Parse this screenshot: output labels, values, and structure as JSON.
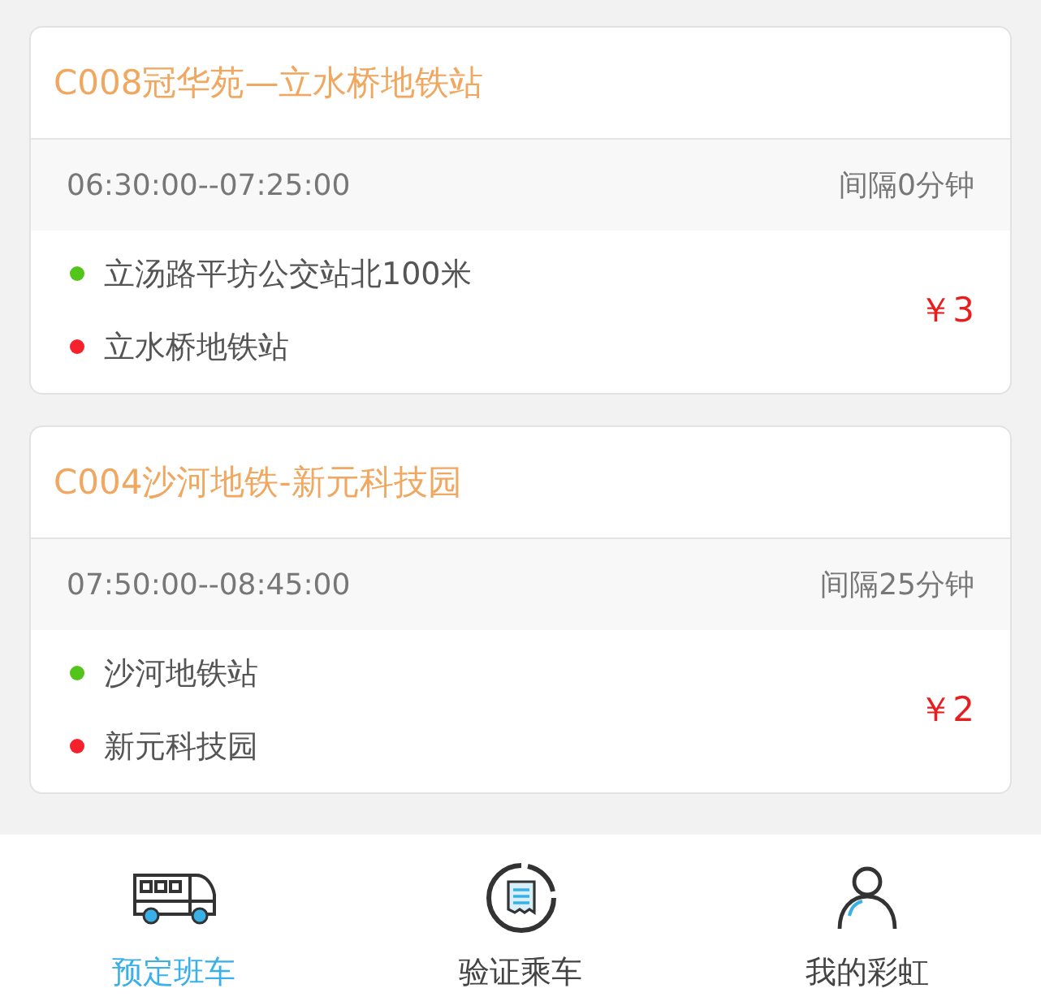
{
  "routes": [
    {
      "title": "C008冠华苑—立水桥地铁站",
      "time": "06:30:00--07:25:00",
      "interval": "间隔0分钟",
      "price": "￥3",
      "stops": [
        {
          "name": "立汤路平坊公交站北100米",
          "color": "#52c41a"
        },
        {
          "name": "立水桥地铁站",
          "color": "#f5222d"
        }
      ]
    },
    {
      "title": "C004沙河地铁-新元科技园",
      "time": "07:50:00--08:45:00",
      "interval": "间隔25分钟",
      "price": "￥2",
      "stops": [
        {
          "name": "沙河地铁站",
          "color": "#52c41a"
        },
        {
          "name": "新元科技园",
          "color": "#f5222d"
        }
      ]
    }
  ],
  "tabs": [
    {
      "label": "预定班车",
      "kind": "bus",
      "selected": true
    },
    {
      "label": "验证乘车",
      "kind": "ticket",
      "selected": false
    },
    {
      "label": "我的彩虹",
      "kind": "person",
      "selected": false
    }
  ]
}
